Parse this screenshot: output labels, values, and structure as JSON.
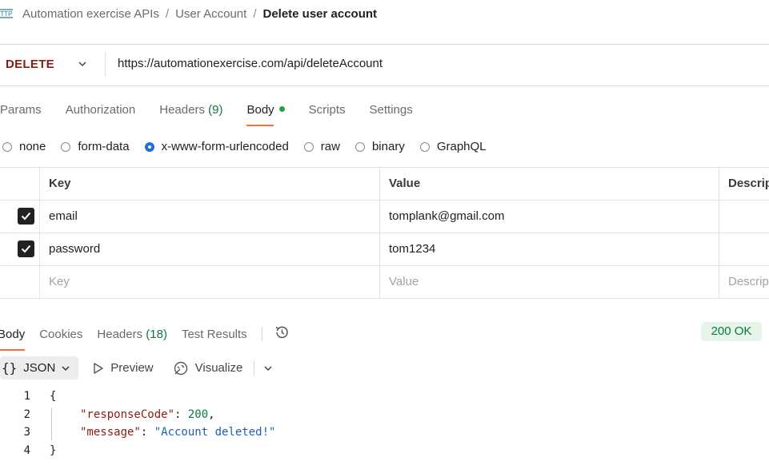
{
  "breadcrumb": {
    "icon_text": "HTTP",
    "items": [
      "Automation exercise APIs",
      "User Account"
    ],
    "separator": "/",
    "current": "Delete user account"
  },
  "request": {
    "method": "DELETE",
    "method_color": "#8b1a10",
    "url": "https://automationexercise.com/api/deleteAccount"
  },
  "request_tabs": {
    "params": "Params",
    "authorization": "Authorization",
    "headers": "Headers",
    "headers_count": "(9)",
    "body": "Body",
    "scripts": "Scripts",
    "settings": "Settings",
    "active": "Body"
  },
  "body_types": {
    "none": "none",
    "form_data": "form-data",
    "urlencoded": "x-www-form-urlencoded",
    "raw": "raw",
    "binary": "binary",
    "graphql": "GraphQL",
    "selected": "x-www-form-urlencoded"
  },
  "params_table": {
    "headers": {
      "key": "Key",
      "value": "Value",
      "description": "Descrip"
    },
    "rows": [
      {
        "checked": true,
        "key": "email",
        "value": "tomplank@gmail.com"
      },
      {
        "checked": true,
        "key": "password",
        "value": "tom1234"
      }
    ],
    "placeholder": {
      "key": "Key",
      "value": "Value",
      "description": "Descrip"
    }
  },
  "response_tabs": {
    "body": "Body",
    "cookies": "Cookies",
    "headers": "Headers",
    "headers_count": "(18)",
    "test_results": "Test Results",
    "active": "Body"
  },
  "status": {
    "text": "200 OK",
    "color": "#0a7a3c"
  },
  "response_toolbar": {
    "format": "JSON",
    "preview": "Preview",
    "visualize": "Visualize"
  },
  "response_body": {
    "line_numbers": [
      "1",
      "2",
      "3",
      "4"
    ],
    "open_brace": "{",
    "close_brace": "}",
    "fields": [
      {
        "key": "\"responseCode\"",
        "value": "200",
        "suffix": ","
      },
      {
        "key": "\"message\"",
        "value": "\"Account deleted!\"",
        "suffix": ""
      }
    ]
  }
}
